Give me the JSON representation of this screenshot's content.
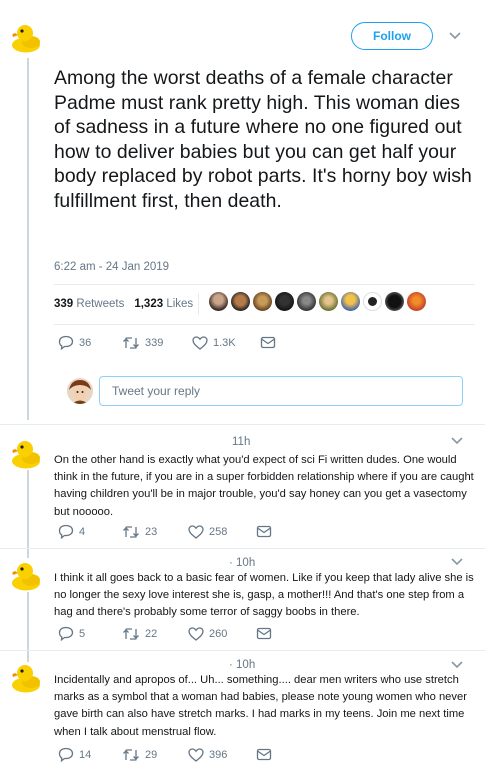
{
  "header": {
    "follow_label": "Follow"
  },
  "main_tweet": {
    "text": "Among the worst deaths of a female character Padme must rank pretty high. This woman dies of sadness in a future where no one figured out how to deliver babies but you can get half your body replaced by robot parts. It's horny boy wish fulfillment first, then death.",
    "timestamp": "6:22 am - 24 Jan 2019",
    "retweets_count": "339",
    "retweets_label": "Retweets",
    "likes_count": "1,323",
    "likes_label": "Likes",
    "actions": {
      "replies": "36",
      "retweets": "339",
      "likes": "1.3K"
    }
  },
  "reply_box": {
    "placeholder": "Tweet your reply"
  },
  "replies": [
    {
      "time": "11h",
      "text": "On the other hand is exactly what you'd expect of sci Fi written dudes. One would think in the future, if you are in a super forbidden relationship where if you are caught having children you'll be in major trouble, you'd say honey can you get a vasectomy but nooooo.",
      "replies": "4",
      "retweets": "23",
      "likes": "258"
    },
    {
      "time": "· 10h",
      "text": "I think it all goes back to a basic fear of women. Like if you keep that lady alive she is no longer the sexy love interest she is, gasp, a mother!!! And that's one step from a hag and there's probably some terror of saggy boobs in there.",
      "replies": "5",
      "retweets": "22",
      "likes": "260"
    },
    {
      "time": "· 10h",
      "text": "Incidentally and apropos of... Uh... something.... dear men writers who use stretch marks as a symbol that a woman had babies, please note young women who never gave birth can also have stretch marks. I had marks in my teens. Join me next time when I talk about menstrual flow.",
      "replies": "14",
      "retweets": "29",
      "likes": "396"
    }
  ],
  "icons": {
    "avatar": "rubber-duck-icon",
    "reply": "reply-icon",
    "retweet": "retweet-icon",
    "like": "heart-icon",
    "message": "envelope-icon",
    "menu": "chevron-down-icon"
  },
  "colors": {
    "accent": "#1da1f2",
    "muted": "#657786",
    "text": "#14171a",
    "divider": "#e6ecf0"
  }
}
